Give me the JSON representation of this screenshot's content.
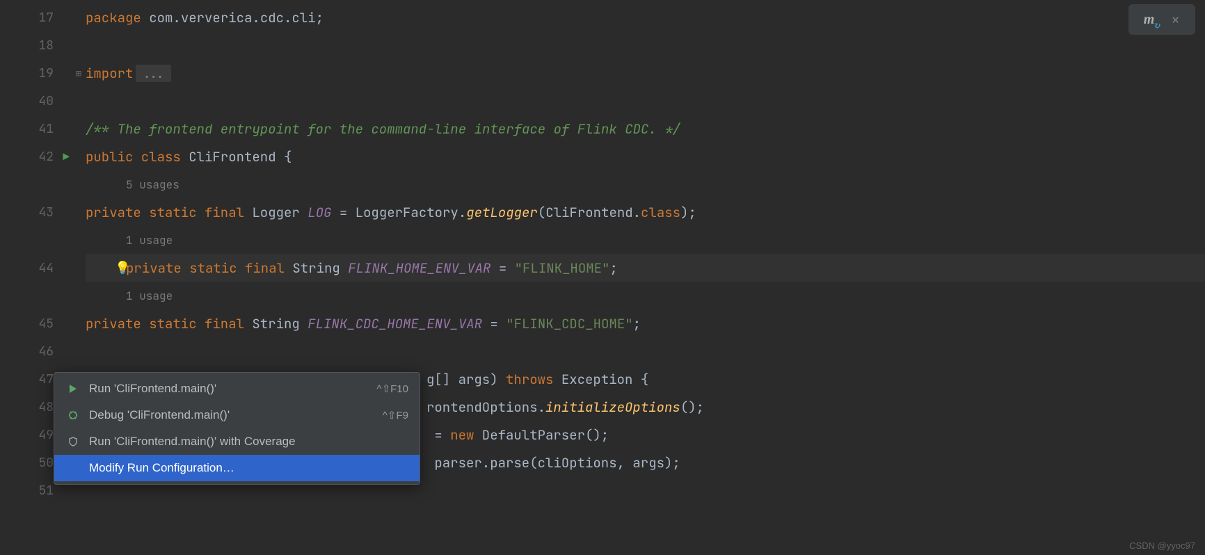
{
  "gutter": {
    "lines": [
      "17",
      "18",
      "19",
      "40",
      "41",
      "42",
      "",
      "43",
      "",
      "44",
      "",
      "45",
      "46",
      "47",
      "48",
      "49",
      "50",
      "51"
    ],
    "run_icons": [
      5,
      13
    ]
  },
  "code": {
    "l17": {
      "kw": "package",
      "rest": " com.ververica.cdc.cli;"
    },
    "l19": {
      "kw": "import",
      "fold": "..."
    },
    "l41": "/** The frontend entrypoint for the command-line interface of Flink CDC. */",
    "l42": {
      "p1": "public class ",
      "p2": "CliFrontend {"
    },
    "hint1": "5 usages",
    "l43": {
      "mods": "private static final ",
      "type": "Logger ",
      "field": "LOG",
      "eq": " = LoggerFactory.",
      "call": "getLogger",
      "rest": "(CliFrontend.",
      "cls": "class",
      "end": ");"
    },
    "hint2": "1 usage",
    "l44": {
      "mods": "private static final ",
      "type": "String ",
      "field": "FLINK_HOME_ENV_VAR",
      "eq": " = ",
      "str": "\"FLINK_HOME\"",
      "end": ";"
    },
    "hint3": "1 usage",
    "l45": {
      "mods": "private static final ",
      "type": "String ",
      "field": "FLINK_CDC_HOME_ENV_VAR",
      "eq": " = ",
      "str": "\"FLINK_CDC_HOME\"",
      "end": ";"
    },
    "l47": {
      "prefix": "g[] args) ",
      "kw": "throws",
      "suffix": " Exception {"
    },
    "l48": {
      "prefix": "rontendOptions.",
      "call": "initializeOptions",
      "suffix": "();"
    },
    "l49": {
      "eq": " = ",
      "kw": "new",
      "rest": " DefaultParser();"
    },
    "l50": {
      "prefix": " parser.parse(cliOptions, args);"
    }
  },
  "menu": {
    "items": [
      {
        "icon": "run",
        "label": "Run 'CliFrontend.main()'",
        "shortcut": "^⇧F10"
      },
      {
        "icon": "debug",
        "label": "Debug 'CliFrontend.main()'",
        "shortcut": "^⇧F9"
      },
      {
        "icon": "coverage",
        "label": "Run 'CliFrontend.main()' with Coverage",
        "shortcut": ""
      },
      {
        "icon": "",
        "label": "Modify Run Configuration…",
        "shortcut": "",
        "selected": true
      }
    ]
  },
  "watermark": "CSDN @yyoc97"
}
